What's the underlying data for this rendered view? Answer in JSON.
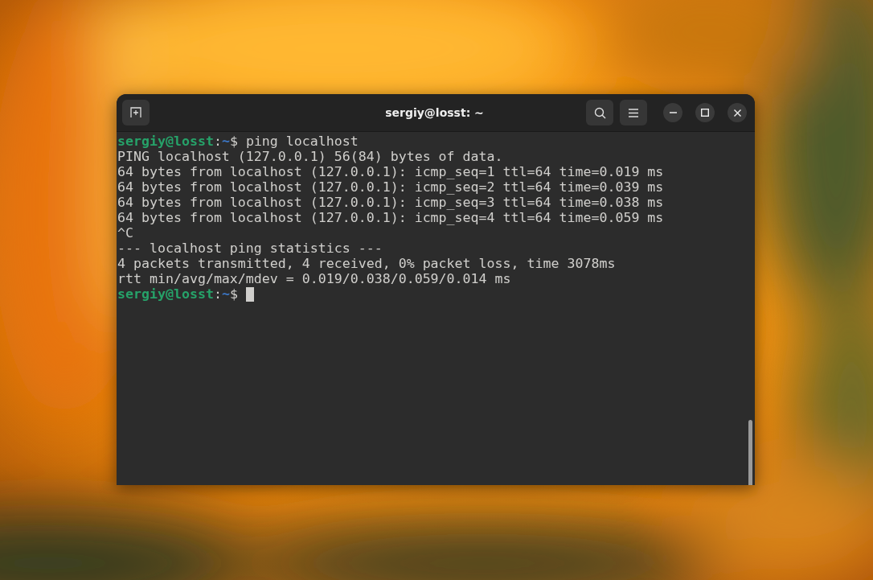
{
  "window": {
    "title": "sergiy@losst: ~"
  },
  "terminal": {
    "lines": [
      {
        "kind": "prompt",
        "user": "sergiy@losst",
        "separator": ":",
        "path": "~",
        "symbol": "$",
        "command": "ping localhost",
        "cursor": false
      },
      {
        "kind": "output",
        "text": "PING localhost (127.0.0.1) 56(84) bytes of data."
      },
      {
        "kind": "output",
        "text": "64 bytes from localhost (127.0.0.1): icmp_seq=1 ttl=64 time=0.019 ms"
      },
      {
        "kind": "output",
        "text": "64 bytes from localhost (127.0.0.1): icmp_seq=2 ttl=64 time=0.039 ms"
      },
      {
        "kind": "output",
        "text": "64 bytes from localhost (127.0.0.1): icmp_seq=3 ttl=64 time=0.038 ms"
      },
      {
        "kind": "output",
        "text": "64 bytes from localhost (127.0.0.1): icmp_seq=4 ttl=64 time=0.059 ms"
      },
      {
        "kind": "output",
        "text": "^C"
      },
      {
        "kind": "output",
        "text": "--- localhost ping statistics ---"
      },
      {
        "kind": "output",
        "text": "4 packets transmitted, 4 received, 0% packet loss, time 3078ms"
      },
      {
        "kind": "output",
        "text": "rtt min/avg/max/mdev = 0.019/0.038/0.059/0.014 ms"
      },
      {
        "kind": "prompt",
        "user": "sergiy@losst",
        "separator": ":",
        "path": "~",
        "symbol": "$",
        "cursor": true
      }
    ]
  }
}
